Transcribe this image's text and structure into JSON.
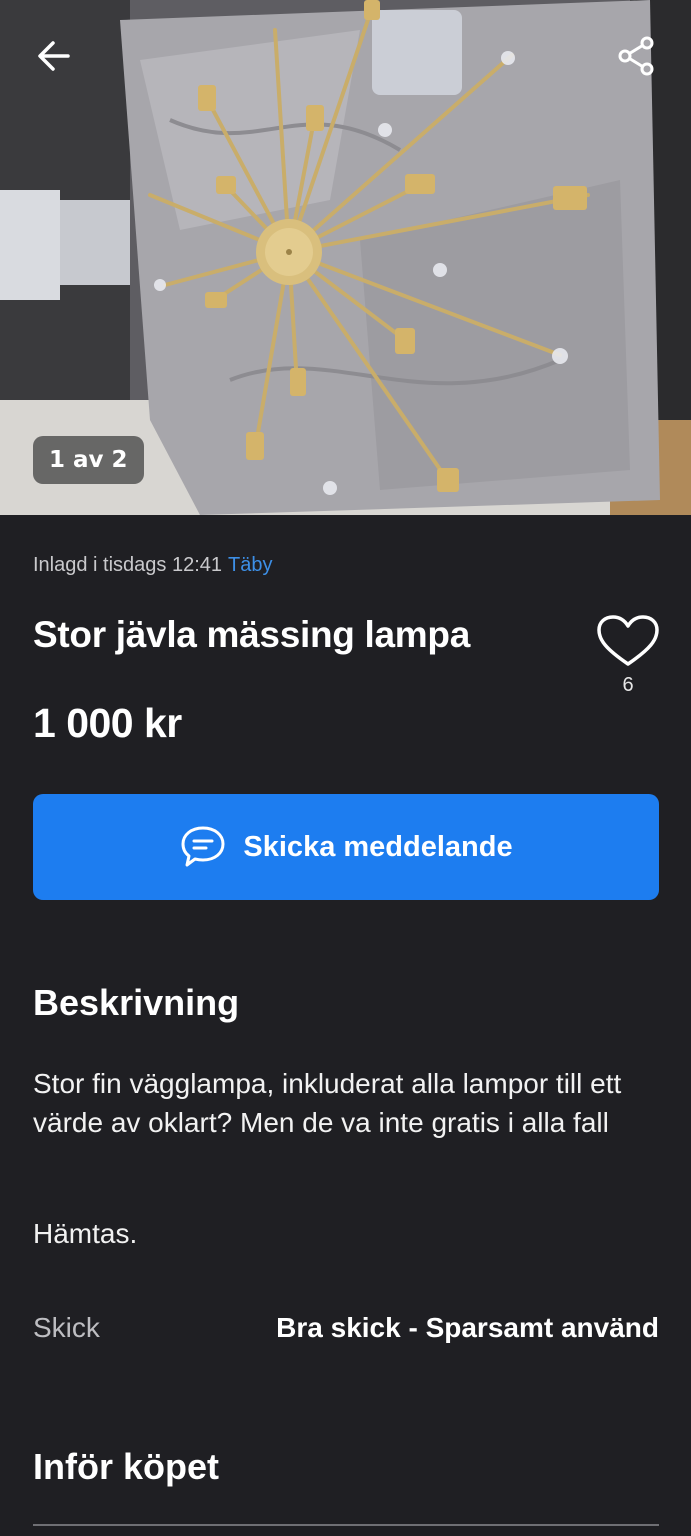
{
  "gallery": {
    "counter": "1 av 2"
  },
  "listing": {
    "posted": "Inlagd i tisdags 12:41",
    "location": "Täby",
    "title": "Stor jävla mässing lampa",
    "favorite_count": "6",
    "price": "1 000 kr"
  },
  "actions": {
    "message_label": "Skicka meddelande"
  },
  "description": {
    "heading": "Beskrivning",
    "text": "Stor fin vägglampa, inkluderat alla lampor till ett värde av oklart? Men de va inte gratis i alla fall",
    "text2": "Hämtas."
  },
  "condition": {
    "label": "Skick",
    "value": "Bra skick - Sparsamt använd"
  },
  "before_purchase": {
    "heading": "Inför köpet"
  },
  "icons": {
    "back": "back-arrow-icon",
    "share": "share-icon",
    "favorite": "heart-icon",
    "message": "chat-bubble-icon"
  },
  "colors": {
    "background": "#1f1f23",
    "accent": "#1d7df0",
    "location_link": "#3d8fe6"
  }
}
